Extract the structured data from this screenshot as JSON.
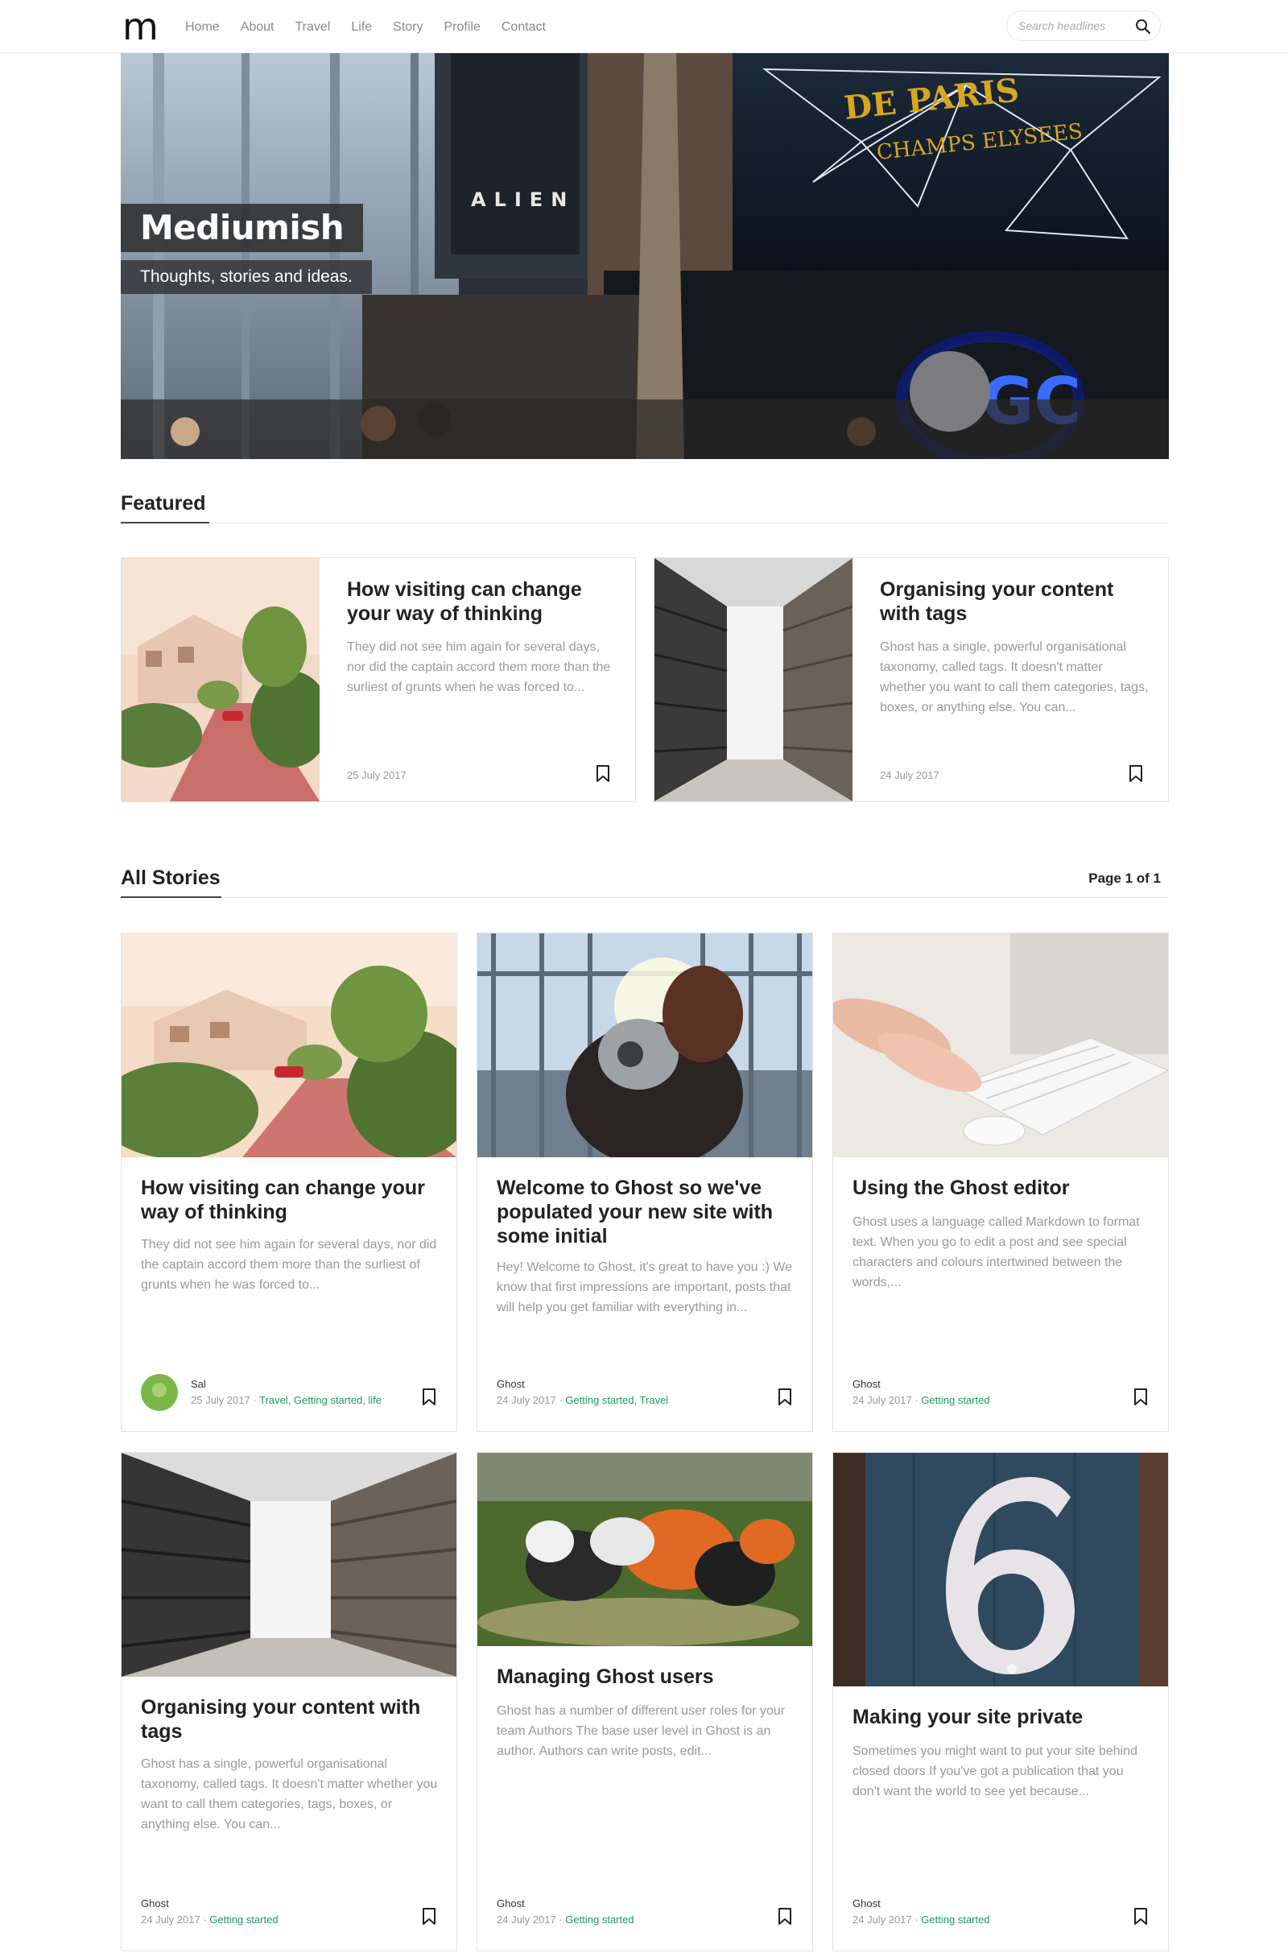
{
  "site": {
    "logo": "m",
    "title": "Mediumish",
    "tagline": "Thoughts, stories and ideas."
  },
  "nav": {
    "items": [
      "Home",
      "About",
      "Travel",
      "Life",
      "Story",
      "Profile",
      "Contact"
    ]
  },
  "search": {
    "placeholder": "Search headlines"
  },
  "featured": {
    "heading": "Featured",
    "posts": [
      {
        "title": "How visiting can change your way of thinking",
        "excerpt": "They did not see him again for several days, nor did the captain accord them more than the surliest of grunts when he was forced to...",
        "date": "25 July 2017"
      },
      {
        "title": "Organising your content with tags",
        "excerpt": "Ghost has a single, powerful organisational taxonomy, called tags. It doesn't matter whether you want to call them categories, tags, boxes, or anything else. You can...",
        "date": "24 July 2017"
      }
    ]
  },
  "stories": {
    "heading": "All Stories",
    "pagination": "Page 1 of 1",
    "posts": [
      {
        "title": "How visiting can change your way of thinking",
        "excerpt": "They did not see him again for several days, nor did the captain accord them more than the surliest of grunts when he was forced to...",
        "author": "Sal",
        "date": "25 July 2017",
        "tags": "Travel, Getting started, life"
      },
      {
        "title": "Welcome to Ghost so we've populated your new site with some initial",
        "excerpt": "Hey! Welcome to Ghost, it's great to have you :) We know that first impressions are important, posts that will help you get familiar with everything in...",
        "author": "Ghost",
        "date": "24 July 2017",
        "tags": "Getting started, Travel"
      },
      {
        "title": "Using the Ghost editor",
        "excerpt": "Ghost uses a language called Markdown to format text. When you go to edit a post and see special characters and colours intertwined between the words,...",
        "author": "Ghost",
        "date": "24 July 2017",
        "tags": "Getting started"
      },
      {
        "title": "Organising your content with tags",
        "excerpt": "Ghost has a single, powerful organisational taxonomy, called tags. It doesn't matter whether you want to call them categories, tags, boxes, or anything else. You can...",
        "author": "Ghost",
        "date": "24 July 2017",
        "tags": "Getting started"
      },
      {
        "title": "Managing Ghost users",
        "excerpt": "Ghost has a number of different user roles for your team Authors The base user level in Ghost is an author. Authors can write posts, edit...",
        "author": "Ghost",
        "date": "24 July 2017",
        "tags": "Getting started"
      },
      {
        "title": "Making your site private",
        "excerpt": "Sometimes you might want to put your site behind closed doors If you've got a publication that you don't want the world to see yet because...",
        "author": "Ghost",
        "date": "24 July 2017",
        "tags": "Getting started"
      }
    ],
    "meta_separator": " · "
  },
  "colors": {
    "tag_green": "#1c9963",
    "text_muted": "#999999",
    "heading": "#222222"
  },
  "icons": [
    "search-icon",
    "bookmark-icon"
  ]
}
